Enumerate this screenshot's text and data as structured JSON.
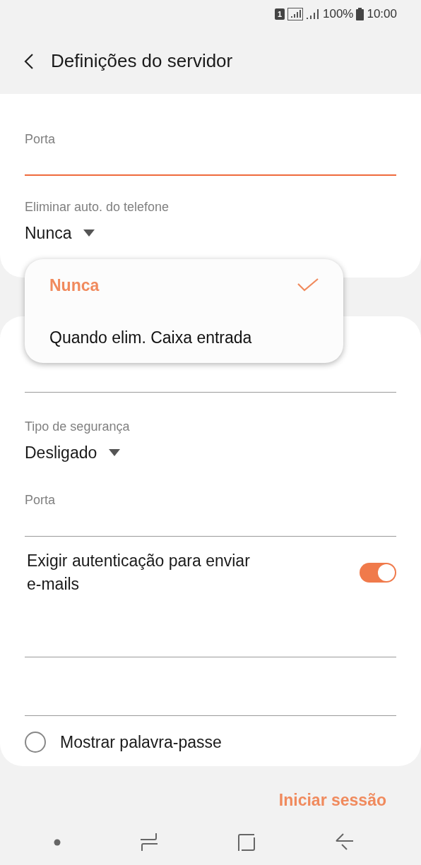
{
  "status_bar": {
    "sim_slot": "1",
    "battery": "100%",
    "time": "10:00"
  },
  "header": {
    "title": "Definições do servidor"
  },
  "incoming": {
    "port": {
      "label": "Porta",
      "focused": true
    },
    "delete_policy": {
      "label": "Eliminar auto. do telefone",
      "value": "Nunca"
    }
  },
  "dropdown_menu": [
    {
      "label": "Nunca",
      "selected": true
    },
    {
      "label": "Quando elim. Caixa entrada",
      "selected": false
    }
  ],
  "outgoing": {
    "security": {
      "label": "Tipo de segurança",
      "value": "Desligado"
    },
    "port": {
      "label": "Porta",
      "focused": false
    },
    "auth": {
      "label": "Exigir autenticação para enviar e-mails",
      "on": true
    },
    "show_password": {
      "label": "Mostrar palavra-passe",
      "checked": false
    }
  },
  "footer": {
    "button": "Iniciar sessão"
  }
}
